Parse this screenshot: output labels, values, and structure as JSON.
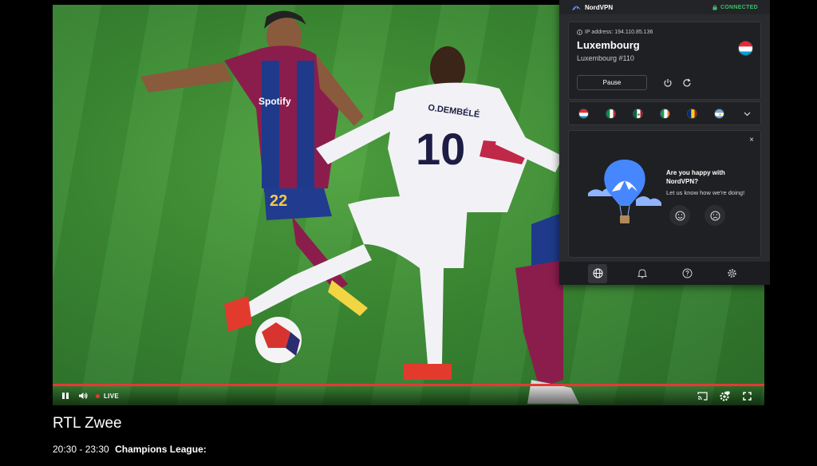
{
  "player": {
    "live_label": "LIVE",
    "progress": 1.0,
    "controls": {
      "play_pause": "pause-icon",
      "volume": "volume-icon",
      "cast": "cast-icon",
      "quality": "settings-hd-icon",
      "fullscreen": "fullscreen-icon"
    },
    "scene": {
      "shirt_number_left": "22",
      "shirt_number_center": "10",
      "shirt_name": "O.DEMBÉLÉ",
      "sponsor": "Spotify"
    }
  },
  "program": {
    "channel": "RTL Zwee",
    "time": "20:30 - 23:30",
    "title": "Champions League:"
  },
  "vpn": {
    "brand": "NordVPN",
    "status": "CONNECTED",
    "ip_label": "IP address: 194.110.85.136",
    "country": "Luxembourg",
    "server": "Luxembourg #110",
    "pause_label": "Pause",
    "quick_flags": [
      "Luxembourg",
      "Italy",
      "Mexico",
      "Ireland",
      "Romania",
      "Argentina"
    ],
    "feedback": {
      "title": "Are you happy with NordVPN?",
      "subtitle": "Let us know how we're doing!",
      "close": "×"
    },
    "nav": [
      "globe-icon",
      "bell-icon",
      "help-icon",
      "settings-icon"
    ]
  },
  "colors": {
    "accent_red": "#e53935",
    "connected_green": "#3fbf6a",
    "panel_bg": "#2a2b2f"
  }
}
